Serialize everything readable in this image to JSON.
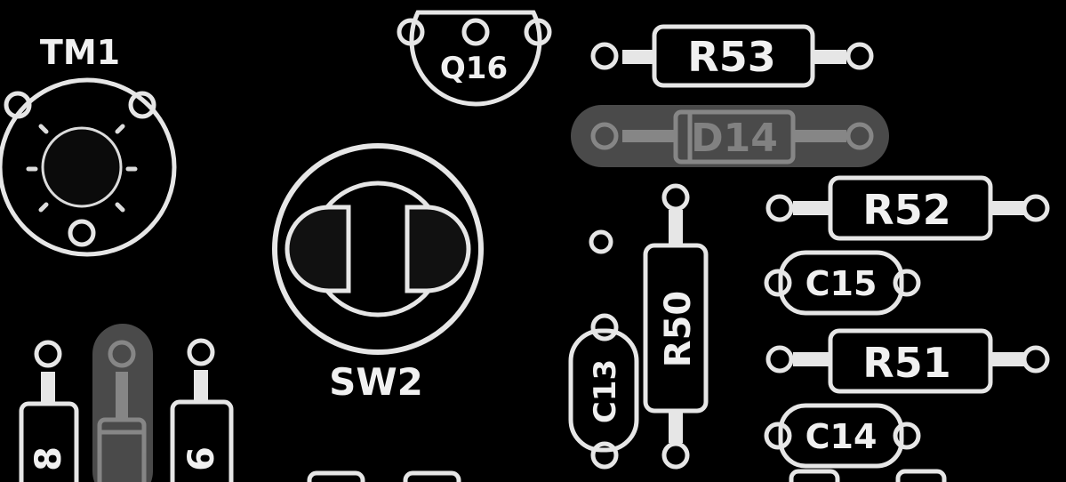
{
  "board": {
    "background": "#000000",
    "silkscreen_color": "#e6e6e6",
    "highlight_color": "#5a5a5a"
  },
  "components": {
    "tm1": "TM1",
    "q16": "Q16",
    "sw2": "SW2",
    "r53": "R53",
    "d14": "D14",
    "r52": "R52",
    "c15": "C15",
    "r51": "R51",
    "c14": "C14",
    "r50": "R50",
    "c13": "C13",
    "r_left1": "8",
    "r_left2": "6"
  }
}
